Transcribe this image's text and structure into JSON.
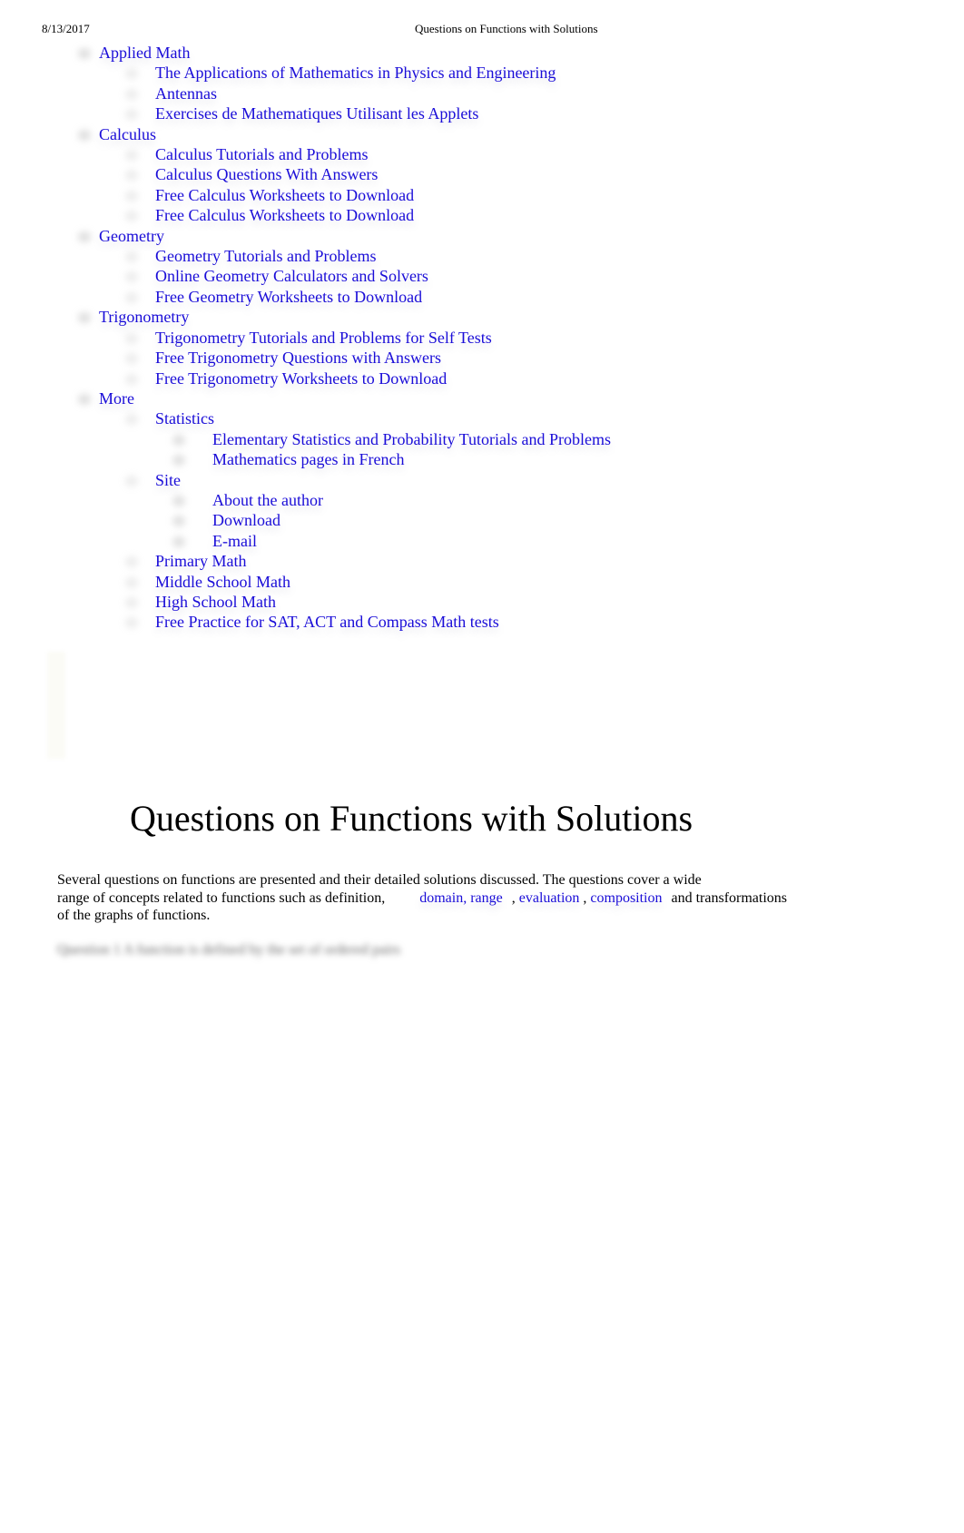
{
  "print_header": {
    "date": "8/13/2017",
    "title": "Questions on Functions with Solutions"
  },
  "nav": {
    "applied_math": {
      "label": "Applied Math",
      "items": [
        "The Applications of Mathematics  in Physics and Engineering",
        "Antennas",
        "Exercises de Mathematiques Utilisant les Applets"
      ]
    },
    "calculus": {
      "label": "Calculus",
      "items": [
        "Calculus Tutorials and Problems",
        "Calculus Questions With Answers",
        "Free Calculus Worksheets to Download",
        "Free Calculus Worksheets to Download"
      ]
    },
    "geometry": {
      "label": "Geometry",
      "items": [
        "Geometry Tutorials and Problems",
        "Online Geometry Calculators and Solvers",
        "Free Geometry Worksheets to Download"
      ]
    },
    "trigonometry": {
      "label": "Trigonometry",
      "items": [
        "Trigonometry Tutorials and Problems for Self Tests",
        "Free Trigonometry Questions with Answers",
        "Free Trigonometry Worksheets to Download"
      ]
    },
    "more": {
      "label": "More",
      "statistics": {
        "label": "Statistics",
        "items": [
          "Elementary Statistics and Probability Tutorials and Problems",
          "Mathematics pages in French"
        ]
      },
      "site": {
        "label": "Site",
        "items": [
          "About the author",
          "Download",
          "E-mail"
        ]
      },
      "items": [
        "Primary Math",
        "Middle School Math",
        "High School Math",
        "Free Practice for SAT, ACT and Compass Math tests"
      ]
    }
  },
  "main": {
    "title": "Questions on Functions with Solutions",
    "intro": {
      "line1": "Several questions on functions are presented and their detailed solutions discussed. The questions cover a wide",
      "line2_start": "range of concepts related to functions such as definition,",
      "link_domain_range": "domain, range",
      "sep1": ",",
      "link_evaluation": "evaluation",
      "sep2": ",",
      "link_composition": "composition",
      "line2_end": "and transformations",
      "line3": "of the graphs of functions."
    },
    "blurred_heading": "Question 1   A function is defined by the set of ordered pairs"
  },
  "colors": {
    "link": "#1a0dd8",
    "text": "#000000",
    "background": "#ffffff"
  }
}
